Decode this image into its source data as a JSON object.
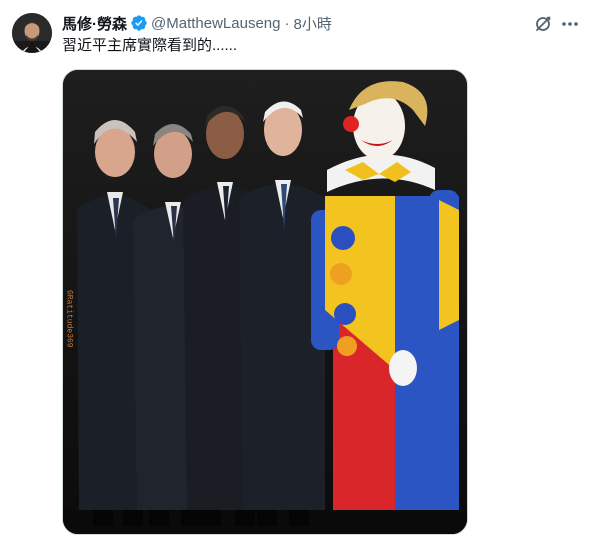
{
  "author": {
    "display_name": "馬修·勞森",
    "handle": "@MatthewLauseng",
    "separator": "·",
    "timestamp": "8小時"
  },
  "tweet": {
    "text": "習近平主席實際看到的......"
  },
  "media": {
    "watermark": "GRatitude369"
  },
  "icons": {
    "avatar": "avatar",
    "verified": "verified-badge-icon",
    "grok": "grok-icon",
    "more": "more-icon"
  },
  "colors": {
    "verified": "#1d9bf0",
    "secondary_text": "#536471",
    "border": "#cfd9de"
  }
}
